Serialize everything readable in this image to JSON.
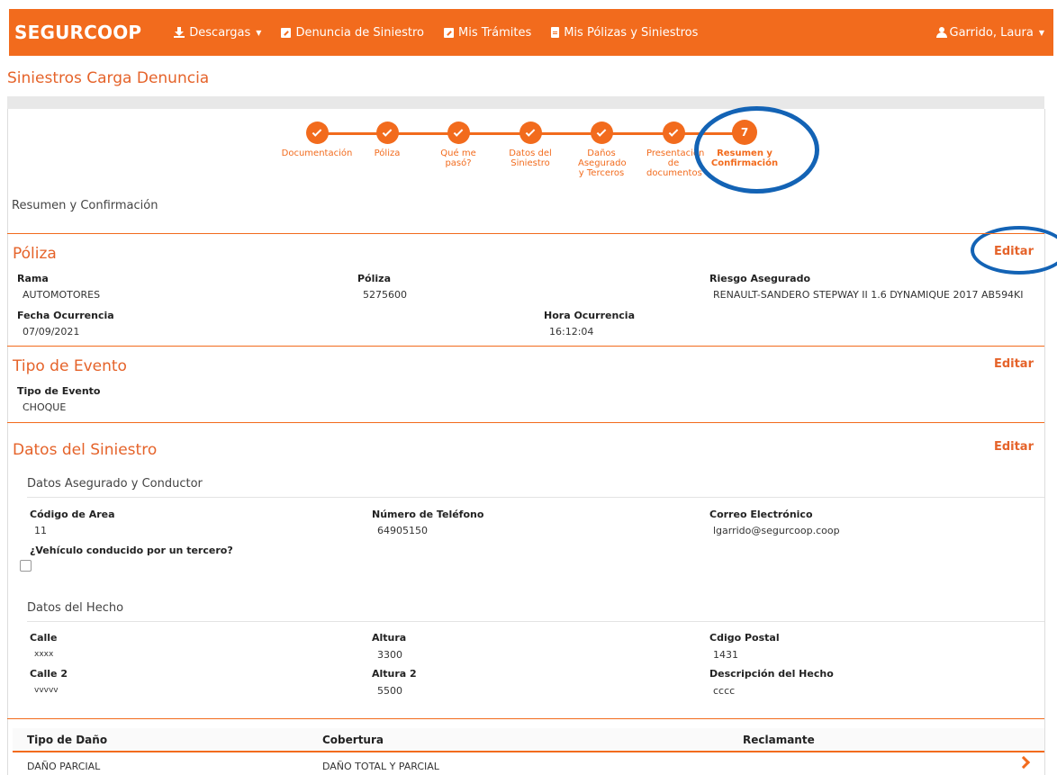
{
  "nav": {
    "brand": "SEGURCOOP",
    "items": [
      {
        "label": "Descargas",
        "icon": "download-icon"
      },
      {
        "label": "Denuncia de Siniestro",
        "icon": "edit-icon"
      },
      {
        "label": "Mis Trámites",
        "icon": "edit-icon"
      },
      {
        "label": "Mis Pólizas y Siniestros",
        "icon": "file-icon"
      }
    ],
    "user": "Garrido, Laura"
  },
  "page_title": "Siniestros Carga Denuncia",
  "stepper": {
    "steps": [
      {
        "label": "Documentación",
        "state": "done"
      },
      {
        "label": "Póliza",
        "state": "done"
      },
      {
        "label": "Qué me pasó?",
        "state": "done"
      },
      {
        "label": "Datos del Siniestro",
        "state": "done"
      },
      {
        "label": "Daños Asegurado y Terceros",
        "state": "done"
      },
      {
        "label": "Presentación de documentos",
        "state": "done"
      },
      {
        "label": "Resumen y Confirmación",
        "state": "active",
        "number": "7"
      }
    ]
  },
  "summary_title": "Resumen y Confirmación",
  "edit_label": "Editar",
  "poliza": {
    "title": "Póliza",
    "rama_label": "Rama",
    "rama": "AUTOMOTORES",
    "poliza_label": "Póliza",
    "poliza": "5275600",
    "riesgo_label": "Riesgo Asegurado",
    "riesgo": "RENAULT-SANDERO STEPWAY II 1.6 DYNAMIQUE 2017 AB594KI",
    "fecha_label": "Fecha Ocurrencia",
    "fecha": "07/09/2021",
    "hora_label": "Hora Ocurrencia",
    "hora": "16:12:04"
  },
  "evento": {
    "title": "Tipo de Evento",
    "tipo_label": "Tipo de Evento",
    "tipo": "CHOQUE"
  },
  "siniestro": {
    "title": "Datos del Siniestro",
    "asegurado_title": "Datos Asegurado y Conductor",
    "codigo_label": "Código de Area",
    "codigo": "11",
    "telefono_label": "Número de Teléfono",
    "telefono": "64905150",
    "correo_label": "Correo Electrónico",
    "correo": "lgarrido@segurcoop.coop",
    "tercero_label": "¿Vehículo conducido por un tercero?",
    "tercero_checked": false,
    "hecho_title": "Datos del Hecho",
    "calle_label": "Calle",
    "calle": "xxxx",
    "altura_label": "Altura",
    "altura": "3300",
    "cp_label": "Cdigo Postal",
    "cp": "1431",
    "calle2_label": "Calle 2",
    "calle2": "vvvvv",
    "altura2_label": "Altura 2",
    "altura2": "5500",
    "desc_label": "Descripción del Hecho",
    "desc": "cccc"
  },
  "danos_table": {
    "headers": [
      "Tipo de Daño",
      "Cobertura",
      "Reclamante"
    ],
    "rows": [
      [
        "DAÑO PARCIAL",
        "DAÑO TOTAL Y PARCIAL",
        ""
      ]
    ]
  },
  "colors": {
    "accent": "#f26b1d",
    "annotation": "#1363b5"
  }
}
